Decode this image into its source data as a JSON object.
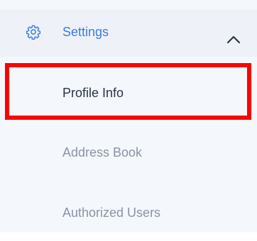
{
  "settings": {
    "label": "Settings",
    "expanded": true,
    "icon": "gear-icon",
    "chevron_icon": "chevron-up-icon",
    "accent_color": "#3f7be3",
    "header_background": "#eef2f8"
  },
  "menu": {
    "items": [
      {
        "label": "Profile Info",
        "highlighted": true
      },
      {
        "label": "Address Book",
        "highlighted": false
      },
      {
        "label": "Authorized Users",
        "highlighted": false
      }
    ]
  },
  "colors": {
    "highlight_border": "#ff0000",
    "active_text": "#2b3445",
    "inactive_text": "#8a94a6",
    "background": "#f4f7fb"
  }
}
